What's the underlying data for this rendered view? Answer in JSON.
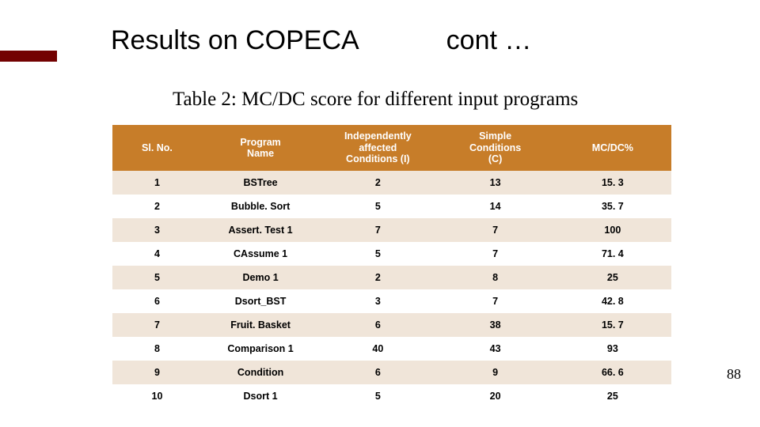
{
  "title": {
    "left": "Results on COPECA",
    "right": "cont …"
  },
  "caption": "Table 2: MC/DC score for different input programs",
  "headers": {
    "sl": "Sl. No.",
    "name": "Program\nName",
    "i": "Independently\naffected\nConditions (I)",
    "c": "Simple\nConditions\n(C)",
    "m": "MC/DC%"
  },
  "chart_data": {
    "type": "table",
    "title": "Table 2: MC/DC score for different input programs",
    "columns": [
      "Sl. No.",
      "Program Name",
      "Independently affected Conditions (I)",
      "Simple Conditions (C)",
      "MC/DC%"
    ],
    "rows": [
      {
        "sl": "1",
        "name": "BSTree",
        "i": "2",
        "c": "13",
        "m": "15. 3"
      },
      {
        "sl": "2",
        "name": "Bubble. Sort",
        "i": "5",
        "c": "14",
        "m": "35. 7"
      },
      {
        "sl": "3",
        "name": "Assert. Test 1",
        "i": "7",
        "c": "7",
        "m": "100"
      },
      {
        "sl": "4",
        "name": "CAssume 1",
        "i": "5",
        "c": "7",
        "m": "71. 4"
      },
      {
        "sl": "5",
        "name": "Demo 1",
        "i": "2",
        "c": "8",
        "m": "25"
      },
      {
        "sl": "6",
        "name": "Dsort_BST",
        "i": "3",
        "c": "7",
        "m": "42. 8"
      },
      {
        "sl": "7",
        "name": "Fruit. Basket",
        "i": "6",
        "c": "38",
        "m": "15. 7"
      },
      {
        "sl": "8",
        "name": "Comparison 1",
        "i": "40",
        "c": "43",
        "m": "93"
      },
      {
        "sl": "9",
        "name": "Condition",
        "i": "6",
        "c": "9",
        "m": "66. 6"
      },
      {
        "sl": "10",
        "name": "Dsort 1",
        "i": "5",
        "c": "20",
        "m": "25"
      }
    ]
  },
  "page_number": "88"
}
